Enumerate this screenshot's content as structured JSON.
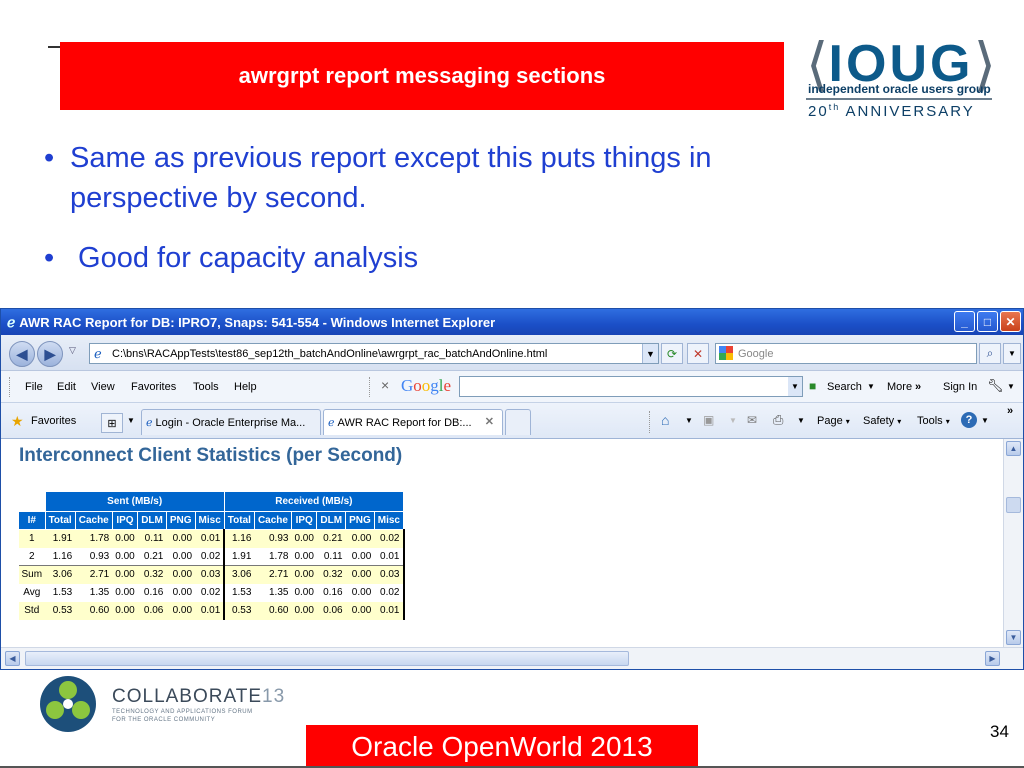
{
  "slide": {
    "title": "awrgrpt report messaging sections",
    "bullets": [
      "Same as previous report except this puts things in perspective by second.",
      " Good for capacity analysis"
    ],
    "page_number": "34",
    "footer_banner": "Oracle OpenWorld 2013"
  },
  "ioug_logo": {
    "bracket_left": "⟨",
    "word": "IOUG",
    "bracket_right": "⟩",
    "subtitle": "independent oracle users group",
    "anniv_num": "20",
    "anniv_sup": "th",
    "anniv_text": " ANNIVERSARY"
  },
  "collaborate_logo": {
    "word": "COLLABORATE",
    "number": "13",
    "tagline_1": "TECHNOLOGY AND APPLICATIONS FORUM",
    "tagline_2": "FOR THE ORACLE COMMUNITY"
  },
  "browser": {
    "window_title": "AWR RAC Report for DB: IPRO7, Snaps: 541-554 - Windows Internet Explorer",
    "address": "C:\\bns\\RACAppTests\\test86_sep12th_batchAndOnline\\awrgrpt_rac_batchAndOnline.html",
    "search_placeholder": "Google",
    "menu": [
      "File",
      "Edit",
      "View",
      "Favorites",
      "Tools",
      "Help"
    ],
    "toolbar": {
      "x": "×",
      "google_letters": [
        "G",
        "o",
        "o",
        "g",
        "l",
        "e"
      ],
      "search": "Search",
      "more": "More",
      "sign_in": "Sign In"
    },
    "favorites_label": "Favorites",
    "tabs": [
      {
        "label": "Login - Oracle Enterprise Ma..."
      },
      {
        "label": "AWR RAC Report for DB:..."
      }
    ],
    "command_bar": {
      "page": "Page",
      "safety": "Safety",
      "tools": "Tools"
    }
  },
  "report": {
    "heading": "Interconnect Client Statistics (per Second)",
    "group_headers": [
      "Sent (MB/s)",
      "Received (MB/s)"
    ],
    "columns": [
      "I#",
      "Total",
      "Cache",
      "IPQ",
      "DLM",
      "PNG",
      "Misc",
      "Total",
      "Cache",
      "IPQ",
      "DLM",
      "PNG",
      "Misc"
    ],
    "rows": [
      [
        "1",
        "1.91",
        "1.78",
        "0.00",
        "0.11",
        "0.00",
        "0.01",
        "1.16",
        "0.93",
        "0.00",
        "0.21",
        "0.00",
        "0.02"
      ],
      [
        "2",
        "1.16",
        "0.93",
        "0.00",
        "0.21",
        "0.00",
        "0.02",
        "1.91",
        "1.78",
        "0.00",
        "0.11",
        "0.00",
        "0.01"
      ]
    ],
    "summary_rows": [
      [
        "Sum",
        "3.06",
        "2.71",
        "0.00",
        "0.32",
        "0.00",
        "0.03",
        "3.06",
        "2.71",
        "0.00",
        "0.32",
        "0.00",
        "0.03"
      ],
      [
        "Avg",
        "1.53",
        "1.35",
        "0.00",
        "0.16",
        "0.00",
        "0.02",
        "1.53",
        "1.35",
        "0.00",
        "0.16",
        "0.00",
        "0.02"
      ],
      [
        "Std",
        "0.53",
        "0.60",
        "0.00",
        "0.06",
        "0.00",
        "0.01",
        "0.53",
        "0.60",
        "0.00",
        "0.06",
        "0.00",
        "0.01"
      ]
    ]
  },
  "colors": {
    "title_red": "#ff0000",
    "bullet_blue": "#1f3fd1",
    "table_header": "#0066cc",
    "heading": "#336699",
    "row_highlight": "#ffffcc"
  }
}
